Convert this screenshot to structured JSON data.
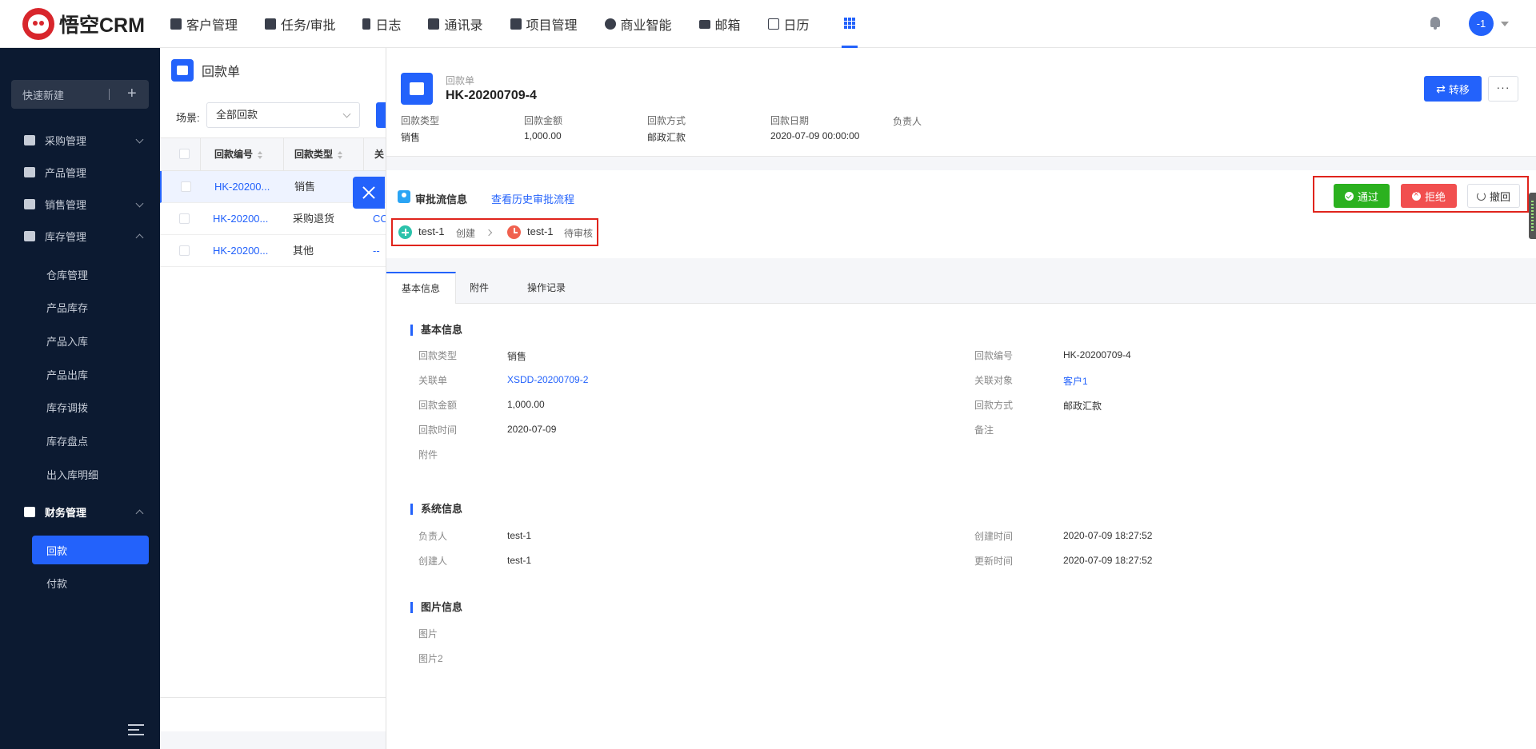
{
  "app": {
    "name": "悟空CRM"
  },
  "topnav": [
    {
      "label": "客户管理"
    },
    {
      "label": "任务/审批"
    },
    {
      "label": "日志"
    },
    {
      "label": "通讯录"
    },
    {
      "label": "项目管理"
    },
    {
      "label": "商业智能"
    },
    {
      "label": "邮箱"
    },
    {
      "label": "日历"
    }
  ],
  "user": {
    "avatar_text": "-1"
  },
  "sidebar": {
    "quick_new": "快速新建",
    "quick_plus": "+",
    "groups": [
      {
        "label": "采购管理"
      },
      {
        "label": "产品管理"
      },
      {
        "label": "销售管理"
      },
      {
        "label": "库存管理"
      },
      {
        "label": "财务管理"
      }
    ],
    "inventory_items": [
      "仓库管理",
      "产品库存",
      "产品入库",
      "产品出库",
      "库存调拨",
      "库存盘点",
      "出入库明细"
    ],
    "finance_items": [
      "回款",
      "付款"
    ]
  },
  "list": {
    "title": "回款单",
    "scene_label": "场景:",
    "scene_value": "全部回款",
    "columns": [
      "回款编号",
      "回款类型",
      "关"
    ],
    "rows": [
      {
        "code": "HK-20200...",
        "type": "销售",
        "extra": ""
      },
      {
        "code": "HK-20200...",
        "type": "采购退货",
        "extra": "CC"
      },
      {
        "code": "HK-20200...",
        "type": "其他",
        "extra": "--"
      }
    ]
  },
  "detail": {
    "subtitle": "回款单",
    "title": "HK-20200709-4",
    "transfer_label": "转移",
    "more_label": "···",
    "summary": [
      {
        "label": "回款类型",
        "value": "销售"
      },
      {
        "label": "回款金额",
        "value": "1,000.00"
      },
      {
        "label": "回款方式",
        "value": "邮政汇款"
      },
      {
        "label": "回款日期",
        "value": "2020-07-09 00:00:00"
      },
      {
        "label": "负责人",
        "value": ""
      }
    ],
    "flow": {
      "title": "审批流信息",
      "history_link": "查看历史审批流程",
      "steps": [
        {
          "user": "test-1",
          "status": "创建"
        },
        {
          "user": "test-1",
          "status": "待审核"
        }
      ],
      "pass": "通过",
      "reject": "拒绝",
      "revoke": "撤回"
    },
    "tabs": [
      "基本信息",
      "附件",
      "操作记录"
    ],
    "basic": {
      "title": "基本信息",
      "left": [
        {
          "label": "回款类型",
          "value": "销售"
        },
        {
          "label": "关联单",
          "value": "XSDD-20200709-2"
        },
        {
          "label": "回款金额",
          "value": "1,000.00"
        },
        {
          "label": "回款时间",
          "value": "2020-07-09"
        },
        {
          "label": "附件",
          "value": ""
        }
      ],
      "right": [
        {
          "label": "回款编号",
          "value": "HK-20200709-4"
        },
        {
          "label": "关联对象",
          "value": "客户1"
        },
        {
          "label": "回款方式",
          "value": "邮政汇款"
        },
        {
          "label": "备注",
          "value": ""
        }
      ]
    },
    "system": {
      "title": "系统信息",
      "left": [
        {
          "label": "负责人",
          "value": "test-1"
        },
        {
          "label": "创建人",
          "value": "test-1"
        }
      ],
      "right": [
        {
          "label": "创建时间",
          "value": "2020-07-09 18:27:52"
        },
        {
          "label": "更新时间",
          "value": "2020-07-09 18:27:52"
        }
      ]
    },
    "images": {
      "title": "图片信息",
      "fields": [
        {
          "label": "图片"
        },
        {
          "label": "图片2"
        }
      ]
    }
  },
  "colors": {
    "primary": "#2362fb",
    "sidebar_bg": "#0c1a31",
    "pass": "#2bb11f",
    "reject": "#f14f4f",
    "highlight_border": "#e0241c"
  }
}
